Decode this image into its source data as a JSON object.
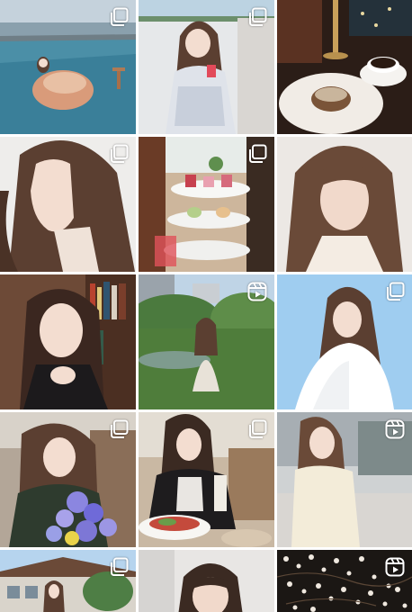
{
  "feed": {
    "posts": [
      {
        "index": 1,
        "badge": "carousel-icon",
        "scene": "pool"
      },
      {
        "index": 2,
        "badge": "carousel-icon",
        "scene": "terrace"
      },
      {
        "index": 3,
        "badge": "none",
        "scene": "cafe-table"
      },
      {
        "index": 4,
        "badge": "carousel-icon",
        "scene": "portrait-side"
      },
      {
        "index": 5,
        "badge": "carousel-icon",
        "scene": "afternoon-tea"
      },
      {
        "index": 6,
        "badge": "none",
        "scene": "portrait-front"
      },
      {
        "index": 7,
        "badge": "none",
        "scene": "bookshelf"
      },
      {
        "index": 8,
        "badge": "reel-icon",
        "scene": "garden"
      },
      {
        "index": 9,
        "badge": "carousel-icon",
        "scene": "sky"
      },
      {
        "index": 10,
        "badge": "carousel-icon",
        "scene": "flowers"
      },
      {
        "index": 11,
        "badge": "carousel-icon",
        "scene": "restaurant"
      },
      {
        "index": 12,
        "badge": "reel-icon",
        "scene": "street"
      },
      {
        "index": 13,
        "badge": "carousel-icon",
        "scene": "building"
      },
      {
        "index": 14,
        "badge": "none",
        "scene": "portrait-dark"
      },
      {
        "index": 15,
        "badge": "reel-icon",
        "scene": "blossoms"
      }
    ]
  },
  "colors": {
    "icon": "#ffffff",
    "hair": "#5b3f31",
    "skin": "#f3ddd0"
  }
}
